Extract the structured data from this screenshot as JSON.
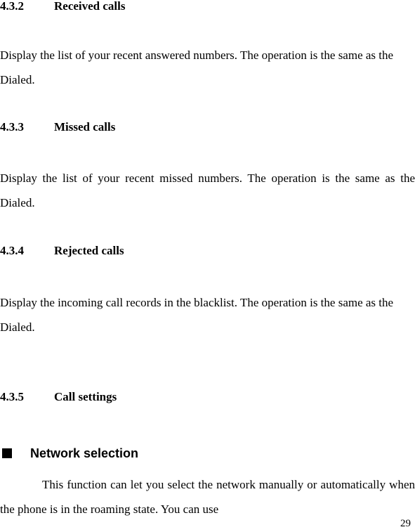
{
  "document": {
    "page_number": "29",
    "sections": [
      {
        "number": "4.3.2",
        "title": "Received calls",
        "body": "Display the list of your recent answered numbers. The operation is the same as the Dialed."
      },
      {
        "number": "4.3.3",
        "title": "Missed calls",
        "body": "Display the list of your recent missed numbers. The operation is the same as the Dialed."
      },
      {
        "number": "4.3.4",
        "title": "Rejected calls",
        "body": "Display the incoming call records in the blacklist. The operation is the same as the Dialed."
      },
      {
        "number": "4.3.5",
        "title": "Call settings",
        "bullet": {
          "marker": "filled-square-bullet",
          "label": "Network selection",
          "body": "This function can let you select the network manually or automatically when the phone is in the roaming state. You can use"
        }
      }
    ]
  }
}
